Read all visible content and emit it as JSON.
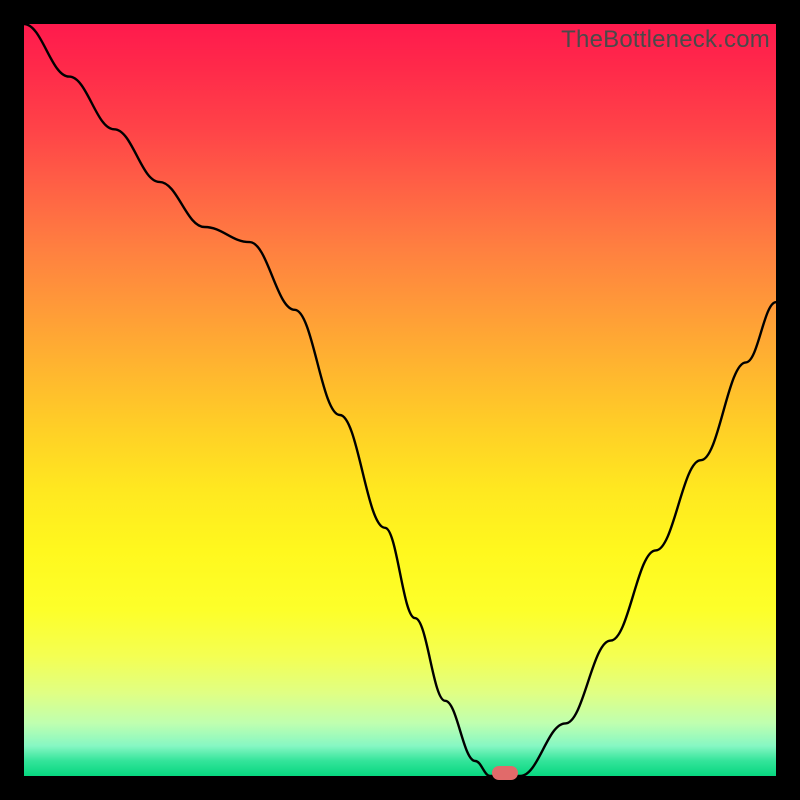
{
  "watermark": "TheBottleneck.com",
  "chart_data": {
    "type": "line",
    "title": "",
    "xlabel": "",
    "ylabel": "",
    "xlim": [
      0,
      100
    ],
    "ylim": [
      0,
      100
    ],
    "x": [
      0,
      6,
      12,
      18,
      24,
      30,
      36,
      42,
      48,
      52,
      56,
      60,
      62,
      66,
      72,
      78,
      84,
      90,
      96,
      100
    ],
    "values": [
      100,
      93,
      86,
      79,
      73,
      71,
      62,
      48,
      33,
      21,
      10,
      2,
      0,
      0,
      7,
      18,
      30,
      42,
      55,
      63
    ],
    "marker": {
      "x": 64,
      "y": 0
    },
    "colors": {
      "gradient_top": "#ff1a4d",
      "gradient_bottom": "#07d780",
      "line": "#000000",
      "marker": "#e16a6a",
      "frame": "#000000"
    }
  }
}
